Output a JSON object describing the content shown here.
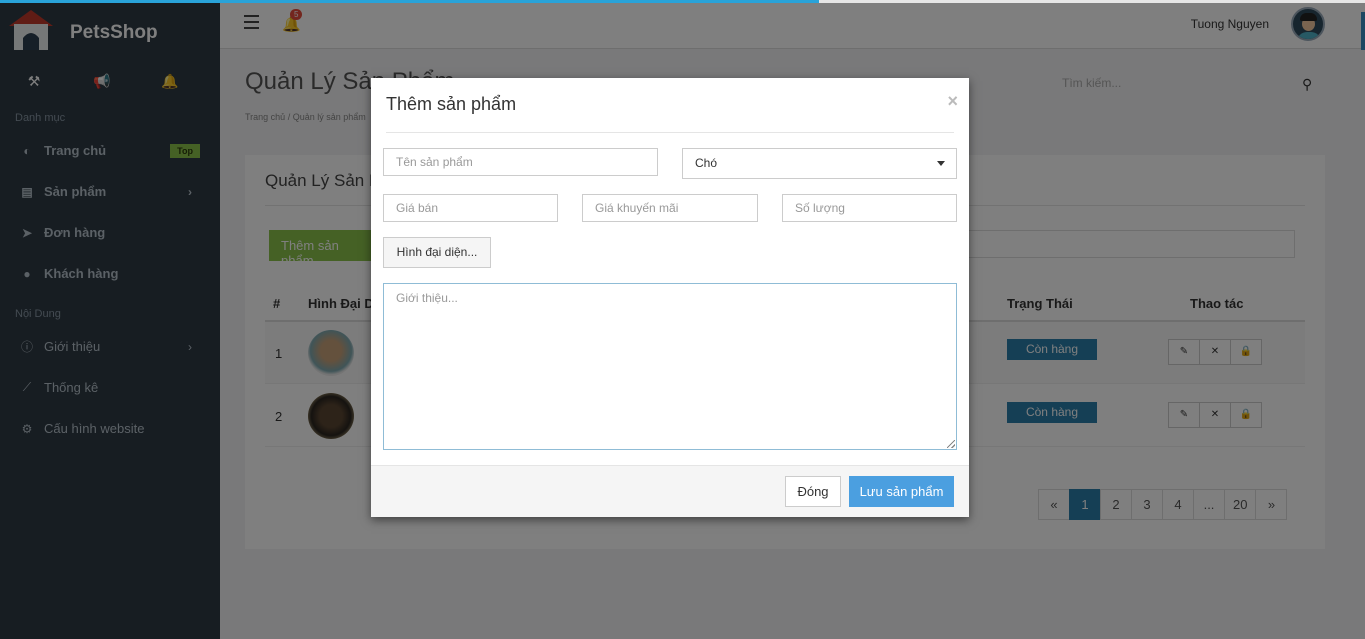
{
  "app": {
    "name": "PetsShop"
  },
  "sidebar": {
    "section1": "Danh mục",
    "section2": "Nội Dung",
    "items": [
      {
        "label": "Trang chủ",
        "badge": "Top"
      },
      {
        "label": "Sản phẩm"
      },
      {
        "label": "Đơn hàng"
      },
      {
        "label": "Khách hàng"
      }
    ],
    "content_items": [
      {
        "label": "Giới thiệu"
      },
      {
        "label": "Thống kê"
      },
      {
        "label": "Cấu hình website"
      }
    ]
  },
  "header": {
    "notification_count": "5",
    "user_name": "Tuong Nguyen"
  },
  "page": {
    "title": "Quản Lý Sản Phẩm",
    "breadcrumb": "Trang chủ  /  Quản lý sản phẩm",
    "search_placeholder": "Tìm kiếm...",
    "panel_title": "Quản Lý Sản Phẩm",
    "add_button": "Thêm sản phẩm",
    "columns": {
      "num": "#",
      "image": "Hình Đại Diện",
      "status": "Trạng Thái",
      "actions": "Thao tác"
    },
    "rows": [
      {
        "num": "1",
        "status": "Còn hàng"
      },
      {
        "num": "2",
        "status": "Còn hàng"
      }
    ],
    "pagination": [
      "«",
      "1",
      "2",
      "3",
      "4",
      "...",
      "20",
      "»"
    ]
  },
  "modal": {
    "title": "Thêm sản phẩm",
    "close_symbol": "×",
    "product_name_placeholder": "Tên sản phẩm",
    "category_selected": "Chó",
    "price_placeholder": "Giá bán",
    "sale_price_placeholder": "Giá khuyến mãi",
    "quantity_placeholder": "Số lượng",
    "image_button": "Hình đại diện...",
    "description_placeholder": "Giới thiệu...",
    "cancel_button": "Đóng",
    "save_button": "Lưu sản phẩm"
  },
  "colors": {
    "accent": "#2a7fab",
    "save": "#4b9fe0",
    "add": "#8bc34a",
    "sidebar": "#2f3b44"
  }
}
